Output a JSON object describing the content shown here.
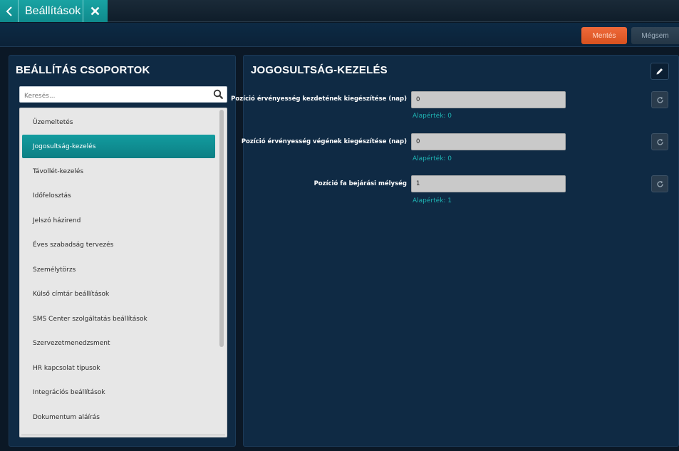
{
  "tab": {
    "title": "Beállítások"
  },
  "actions": {
    "save_label": "Mentés",
    "cancel_label": "Mégsem"
  },
  "left_panel": {
    "title": "BEÁLLÍTÁS CSOPORTOK",
    "search_placeholder": "Keresés...",
    "items": [
      {
        "label": "Üzemeltetés",
        "active": false
      },
      {
        "label": "Jogosultság-kezelés",
        "active": true
      },
      {
        "label": "Távollét-kezelés",
        "active": false
      },
      {
        "label": "Időfelosztás",
        "active": false
      },
      {
        "label": "Jelszó házirend",
        "active": false
      },
      {
        "label": "Éves szabadság tervezés",
        "active": false
      },
      {
        "label": "Személytörzs",
        "active": false
      },
      {
        "label": "Külső címtár beállítások",
        "active": false
      },
      {
        "label": "SMS Center szolgáltatás beállítások",
        "active": false
      },
      {
        "label": "Szervezetmenedzsment",
        "active": false
      },
      {
        "label": "HR kapcsolat típusok",
        "active": false
      },
      {
        "label": "Integrációs beállítások",
        "active": false
      },
      {
        "label": "Dokumentum aláírás",
        "active": false
      }
    ]
  },
  "right_panel": {
    "title": "JOGOSULTSÁG-KEZELÉS",
    "fields": [
      {
        "label": "Pozíció érvényesség kezdetének kiegészítése (nap)",
        "value": "0",
        "default": "Alapérték: 0"
      },
      {
        "label": "Pozíció érvényesség végének kiegészítése (nap)",
        "value": "0",
        "default": "Alapérték: 0"
      },
      {
        "label": "Pozíció fa bejárási mélység",
        "value": "1",
        "default": "Alapérték: 1"
      }
    ]
  },
  "colors": {
    "accent_teal": "#139c9f",
    "save_orange": "#ef6a3a",
    "panel_bg": "#0f2a44",
    "default_text": "#1fb3b3"
  },
  "icons": [
    "back-arrow-icon",
    "close-icon",
    "search-icon",
    "pencil-icon",
    "refresh-icon"
  ]
}
